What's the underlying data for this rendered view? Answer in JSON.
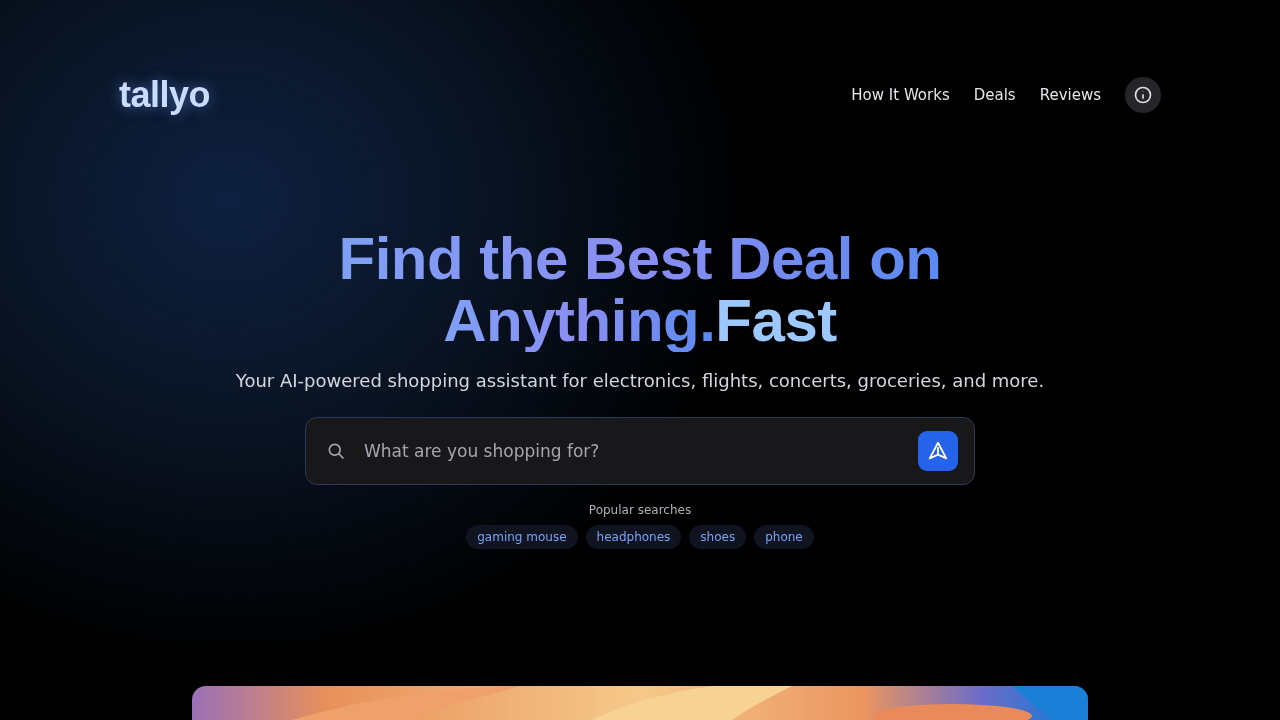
{
  "logo": "tallyo",
  "nav": [
    {
      "label": "How It Works"
    },
    {
      "label": "Deals"
    },
    {
      "label": "Reviews"
    }
  ],
  "hero": {
    "title_line_1": "Find the Best Deal on",
    "title_line_2": "Anything.",
    "title_accent": "Fast",
    "subtitle": "Your AI-powered shopping assistant for electronics, flights, concerts, groceries, and more."
  },
  "search": {
    "placeholder": "What are you shopping for?"
  },
  "popular": {
    "label": "Popular searches",
    "items": [
      "gaming mouse",
      "headphones",
      "shoes",
      "phone"
    ]
  }
}
